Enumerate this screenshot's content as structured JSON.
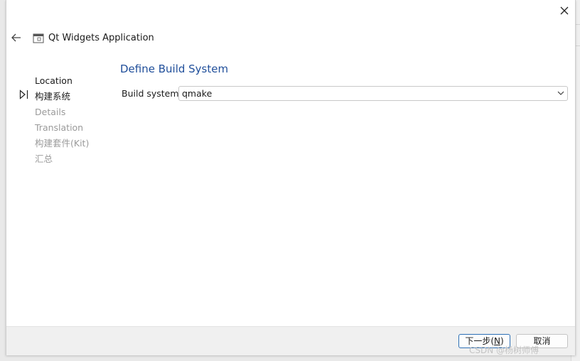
{
  "window": {
    "title": "Qt Widgets Application",
    "icon": "window-icon",
    "close_icon": "close-icon",
    "back_icon": "back-arrow-icon"
  },
  "steps": {
    "items": [
      {
        "label": "Location",
        "state": "done"
      },
      {
        "label": "构建系统",
        "state": "current"
      },
      {
        "label": "Details",
        "state": "pending"
      },
      {
        "label": "Translation",
        "state": "pending"
      },
      {
        "label": "构建套件(Kit)",
        "state": "pending"
      },
      {
        "label": "汇总",
        "state": "pending"
      }
    ],
    "current_marker_icon": "play-outline-icon"
  },
  "page": {
    "heading": "Define Build System",
    "build_system_label": "Build system:",
    "build_system_value": "qmake",
    "dropdown_icon": "chevron-down-icon"
  },
  "footer": {
    "next_label": "下一步(N)",
    "next_mnemonic": "N",
    "cancel_label": "取消"
  },
  "watermark": "CSDN @杨树师傅",
  "colors": {
    "heading": "#1f4e9a",
    "default_button_border": "#2c6fb5",
    "pending_step": "#9a9a9a"
  }
}
